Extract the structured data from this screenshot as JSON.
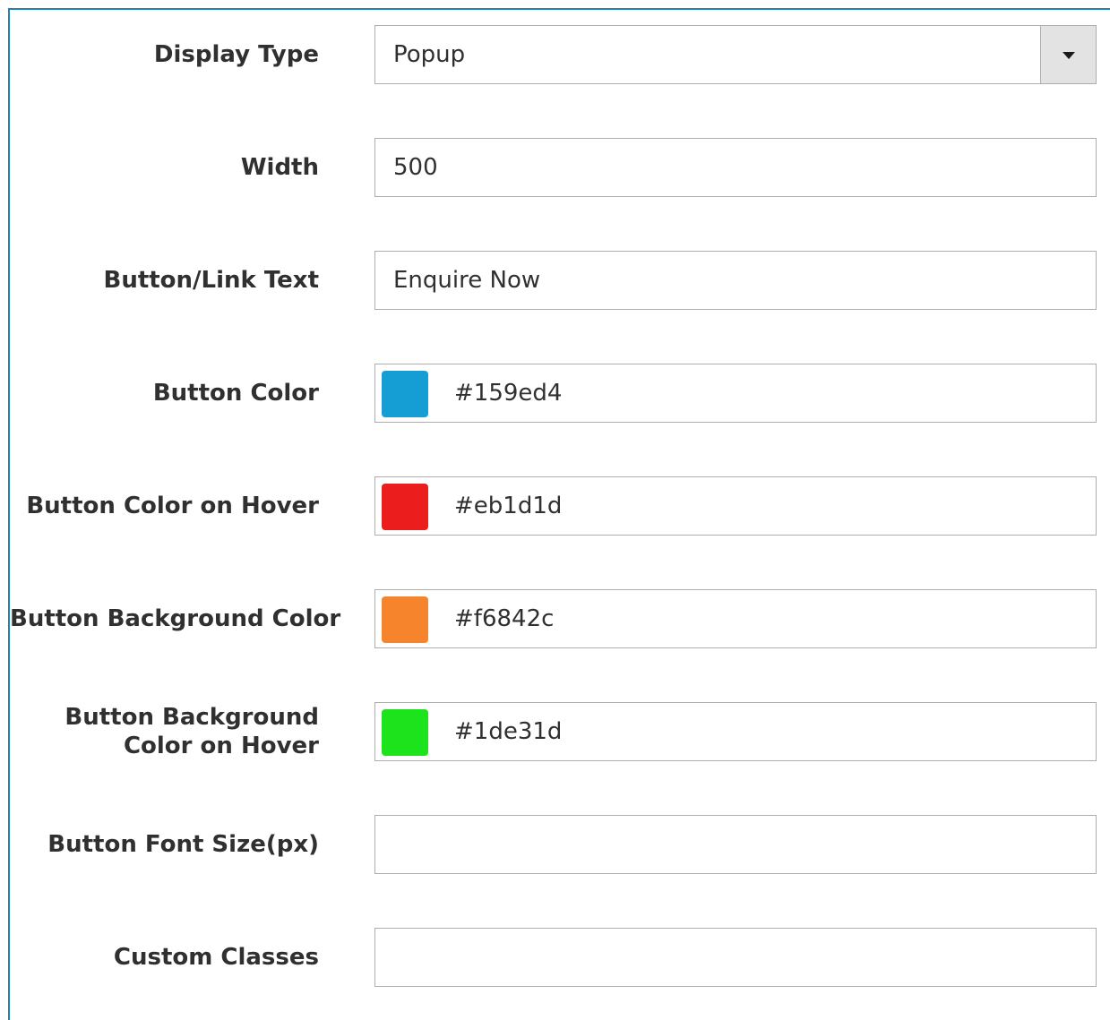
{
  "form": {
    "display_type": {
      "label": "Display Type",
      "value": "Popup",
      "icon": "chevron-down-icon"
    },
    "width": {
      "label": "Width",
      "value": "500"
    },
    "button_link_text": {
      "label": "Button/Link Text",
      "value": "Enquire Now"
    },
    "button_color": {
      "label": "Button Color",
      "value": "#159ed4"
    },
    "button_color_hover": {
      "label": "Button Color on Hover",
      "value": "#eb1d1d"
    },
    "button_bg_color": {
      "label": "Button Background Color",
      "value": "#f6842c"
    },
    "button_bg_color_hover": {
      "label": "Button Background Color on Hover",
      "value": "#1de31d"
    },
    "button_font_size": {
      "label": "Button Font Size(px)",
      "value": ""
    },
    "custom_classes": {
      "label": "Custom Classes",
      "value": ""
    }
  },
  "colors": {
    "frame_border": "#1d85b6",
    "field_border": "#adadad",
    "select_button_bg": "#e3e3e3"
  }
}
